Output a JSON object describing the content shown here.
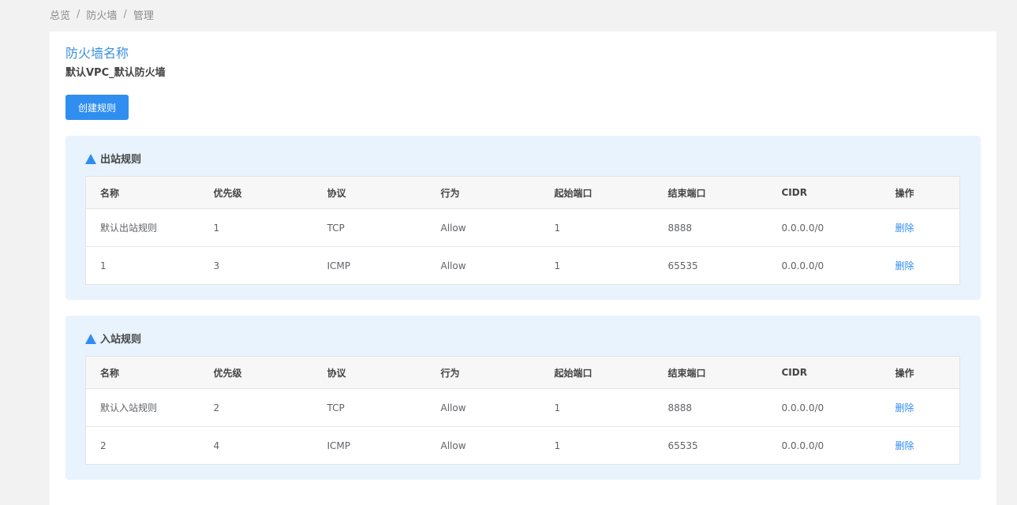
{
  "breadcrumb": {
    "items": [
      "总览",
      "防火墙",
      "管理"
    ],
    "separator": "/"
  },
  "firewall": {
    "label": "防火墙名称",
    "name": "默认VPC_默认防火墙"
  },
  "create_button": "创建规则",
  "columns": [
    "名称",
    "优先级",
    "协议",
    "行为",
    "起始端口",
    "结束端口",
    "CIDR",
    "操作"
  ],
  "outbound": {
    "title": "出站规则",
    "rows": [
      {
        "name": "默认出站规则",
        "priority": "1",
        "protocol": "TCP",
        "action": "Allow",
        "start_port": "1",
        "end_port": "8888",
        "cidr": "0.0.0.0/0",
        "op": "删除"
      },
      {
        "name": "1",
        "priority": "3",
        "protocol": "ICMP",
        "action": "Allow",
        "start_port": "1",
        "end_port": "65535",
        "cidr": "0.0.0.0/0",
        "op": "删除"
      }
    ]
  },
  "inbound": {
    "title": "入站规则",
    "rows": [
      {
        "name": "默认入站规则",
        "priority": "2",
        "protocol": "TCP",
        "action": "Allow",
        "start_port": "1",
        "end_port": "8888",
        "cidr": "0.0.0.0/0",
        "op": "删除"
      },
      {
        "name": "2",
        "priority": "4",
        "protocol": "ICMP",
        "action": "Allow",
        "start_port": "1",
        "end_port": "65535",
        "cidr": "0.0.0.0/0",
        "op": "删除"
      }
    ]
  },
  "colors": {
    "accent": "#2f8ef0",
    "panel_bg": "#e8f3fd",
    "page_bg": "#f2f2f2",
    "title_blue": "#3c8fe0"
  },
  "icons": {
    "section_marker": "triangle-up-icon"
  }
}
